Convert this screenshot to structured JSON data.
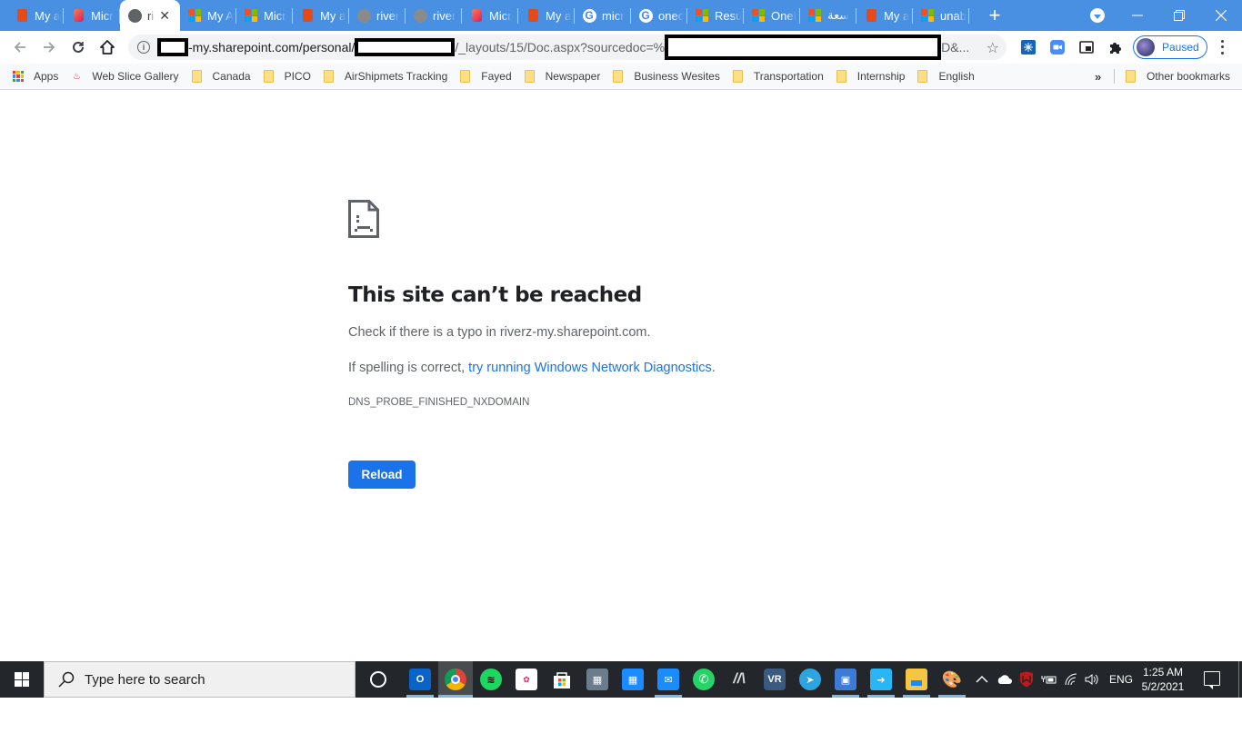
{
  "browser": {
    "tabs": [
      {
        "title": "My a",
        "icon": "office-icon",
        "active": false
      },
      {
        "title": "Micr",
        "icon": "office-new-icon",
        "active": false
      },
      {
        "title": "ri",
        "icon": "globe-icon",
        "active": true
      },
      {
        "title": "My A",
        "icon": "microsoft-icon",
        "active": false
      },
      {
        "title": "Micr",
        "icon": "microsoft-icon",
        "active": false
      },
      {
        "title": "My a",
        "icon": "office-icon",
        "active": false
      },
      {
        "title": "river",
        "icon": "globe-icon",
        "active": false
      },
      {
        "title": "river",
        "icon": "globe-icon",
        "active": false
      },
      {
        "title": "Micr",
        "icon": "office-new-icon",
        "active": false
      },
      {
        "title": "My a",
        "icon": "office-icon",
        "active": false
      },
      {
        "title": "micr",
        "icon": "google-icon",
        "active": false
      },
      {
        "title": "onec",
        "icon": "google-icon",
        "active": false
      },
      {
        "title": "Resu",
        "icon": "microsoft-icon",
        "active": false
      },
      {
        "title": "OneI",
        "icon": "microsoft-icon",
        "active": false
      },
      {
        "title": "سعة",
        "icon": "microsoft-icon",
        "active": false
      },
      {
        "title": "My a",
        "icon": "office-icon",
        "active": false
      },
      {
        "title": "unab",
        "icon": "microsoft-icon",
        "active": false
      }
    ],
    "new_tab_label": "+",
    "url": {
      "host_suffix": "-my.sharepoint.com/personal/",
      "path_mid": "/_layouts/15/Doc.aspx?sourcedoc=%",
      "path_end": "D&..."
    },
    "profile": {
      "label": "Paused"
    },
    "accent": "#4a90e2"
  },
  "bookmarks": {
    "items": [
      {
        "label": "Apps",
        "icon": "apps-grid-icon"
      },
      {
        "label": "Web Slice Gallery",
        "icon": "web-slice-icon"
      },
      {
        "label": "Canada",
        "icon": "folder-icon"
      },
      {
        "label": "PICO",
        "icon": "folder-icon"
      },
      {
        "label": "AirShipmets Tracking",
        "icon": "folder-icon"
      },
      {
        "label": "Fayed",
        "icon": "folder-icon"
      },
      {
        "label": "Newspaper",
        "icon": "folder-icon"
      },
      {
        "label": "Business Wesites",
        "icon": "folder-icon"
      },
      {
        "label": "Transportation",
        "icon": "folder-icon"
      },
      {
        "label": "Internship",
        "icon": "folder-icon"
      },
      {
        "label": "English",
        "icon": "folder-icon"
      }
    ],
    "overflow_label": "»",
    "other": "Other bookmarks"
  },
  "error_page": {
    "title": "This site can’t be reached",
    "line1": "Check if there is a typo in riverz-my.sharepoint.com.",
    "line2_prefix": "If spelling is correct, ",
    "line2_link": "try running Windows Network Diagnostics",
    "line2_suffix": ".",
    "error_code": "DNS_PROBE_FINISHED_NXDOMAIN",
    "reload_label": "Reload"
  },
  "taskbar": {
    "search_placeholder": "Type here to search",
    "apps": [
      "Outlook",
      "Chrome",
      "Spotify",
      "Photos",
      "Microsoft Store",
      "Calculator",
      "Calendar",
      "Mail",
      "WhatsApp",
      "App",
      "VR",
      "Telegram",
      "Control Panel",
      "Remote",
      "File Explorer",
      "Paint"
    ],
    "language": "ENG",
    "time": "1:25 AM",
    "date": "5/2/2021"
  }
}
